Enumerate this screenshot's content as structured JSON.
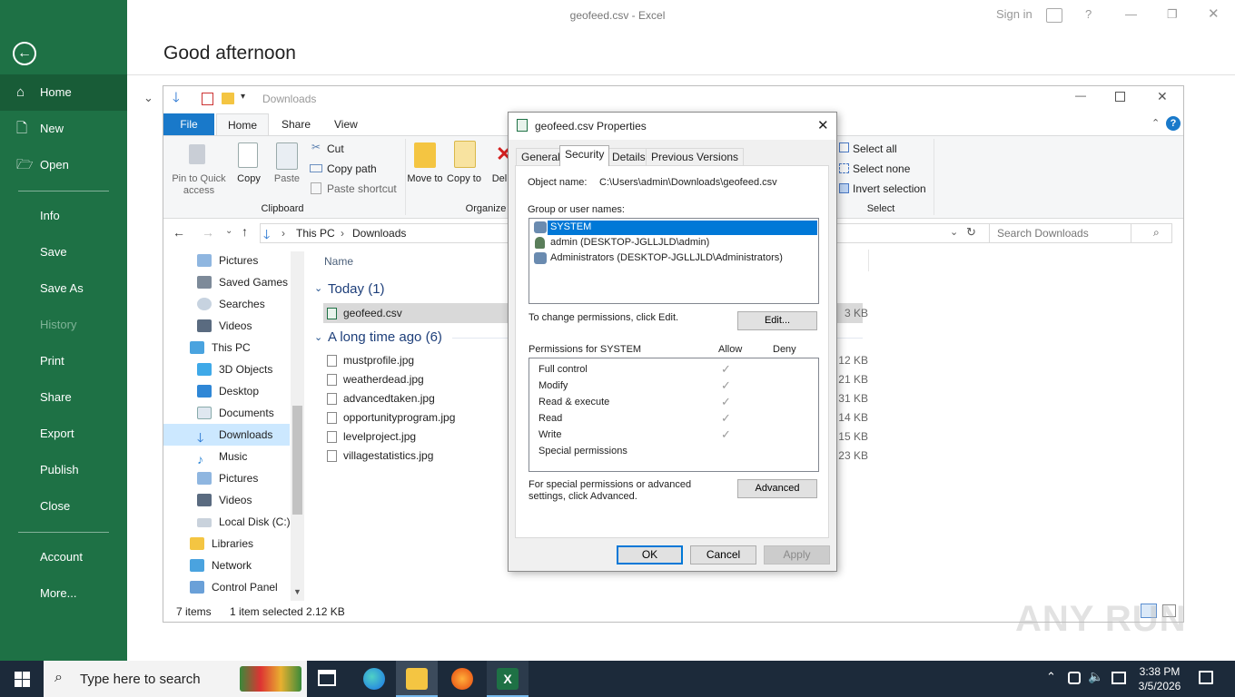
{
  "window_title": "geofeed.csv  -  Excel",
  "titlebar": {
    "signin": "Sign in",
    "help": "?",
    "min": "—",
    "restore": "❐",
    "close": "✕"
  },
  "backstage": {
    "greeting": "Good afternoon",
    "back": "←",
    "items": [
      {
        "label": "Home",
        "icon": "⌂"
      },
      {
        "label": "New",
        "icon": "🗋"
      },
      {
        "label": "Open",
        "icon": "🗁"
      },
      {
        "label": "Info"
      },
      {
        "label": "Save"
      },
      {
        "label": "Save As"
      },
      {
        "label": "History"
      },
      {
        "label": "Print"
      },
      {
        "label": "Share"
      },
      {
        "label": "Export"
      },
      {
        "label": "Publish"
      },
      {
        "label": "Close"
      },
      {
        "label": "Account"
      },
      {
        "label": "More..."
      }
    ]
  },
  "explorer": {
    "title": "Downloads",
    "tabs": [
      "File",
      "Home",
      "Share",
      "View"
    ],
    "clipboard": {
      "pin": "Pin to Quick access",
      "copy": "Copy",
      "paste": "Paste",
      "cut": "Cut",
      "copy_path": "Copy path",
      "paste_shortcut": "Paste shortcut",
      "group": "Clipboard"
    },
    "organize": {
      "move": "Move to",
      "copy": "Copy to",
      "delete": "Del",
      "group": "Organize"
    },
    "select": {
      "all": "Select all",
      "none": "Select none",
      "invert": "Invert selection",
      "group": "Select"
    },
    "breadcrumb": [
      "This PC",
      "Downloads"
    ],
    "search_placeholder": "Search Downloads",
    "nav": [
      "Pictures",
      "Saved Games",
      "Searches",
      "Videos",
      "This PC",
      "3D Objects",
      "Desktop",
      "Documents",
      "Downloads",
      "Music",
      "Pictures",
      "Videos",
      "Local Disk (C:)",
      "Libraries",
      "Network",
      "Control Panel"
    ],
    "col_name": "Name",
    "group_today": "Today (1)",
    "group_old": "A long time ago (6)",
    "files": [
      {
        "name": "geofeed.csv",
        "size": "3 KB"
      },
      {
        "name": "mustprofile.jpg",
        "size": "12 KB"
      },
      {
        "name": "weatherdead.jpg",
        "size": "21 KB"
      },
      {
        "name": "advancedtaken.jpg",
        "size": "31 KB"
      },
      {
        "name": "opportunityprogram.jpg",
        "size": "14 KB"
      },
      {
        "name": "levelproject.jpg",
        "size": "15 KB"
      },
      {
        "name": "villagestatistics.jpg",
        "size": "23 KB"
      }
    ],
    "status_items": "7 items",
    "status_selected": "1 item selected  2.12 KB"
  },
  "dialog": {
    "title": "geofeed.csv Properties",
    "tabs": [
      "General",
      "Security",
      "Details",
      "Previous Versions"
    ],
    "object_label": "Object name:",
    "object_value": "C:\\Users\\admin\\Downloads\\geofeed.csv",
    "group_label": "Group or user names:",
    "users": [
      "SYSTEM",
      "admin (DESKTOP-JGLLJLD\\admin)",
      "Administrators (DESKTOP-JGLLJLD\\Administrators)"
    ],
    "change_text": "To change permissions, click Edit.",
    "edit": "Edit...",
    "perm_label": "Permissions for SYSTEM",
    "allow": "Allow",
    "deny": "Deny",
    "perms": [
      "Full control",
      "Modify",
      "Read & execute",
      "Read",
      "Write",
      "Special permissions"
    ],
    "check": "✓",
    "special_text": "For special permissions or advanced settings, click Advanced.",
    "advanced": "Advanced",
    "ok": "OK",
    "cancel": "Cancel",
    "apply": "Apply"
  },
  "taskbar": {
    "search_placeholder": "Type here to search",
    "time": "3:38 PM",
    "date": "3/5/2026"
  },
  "watermark": "ANY  RUN"
}
